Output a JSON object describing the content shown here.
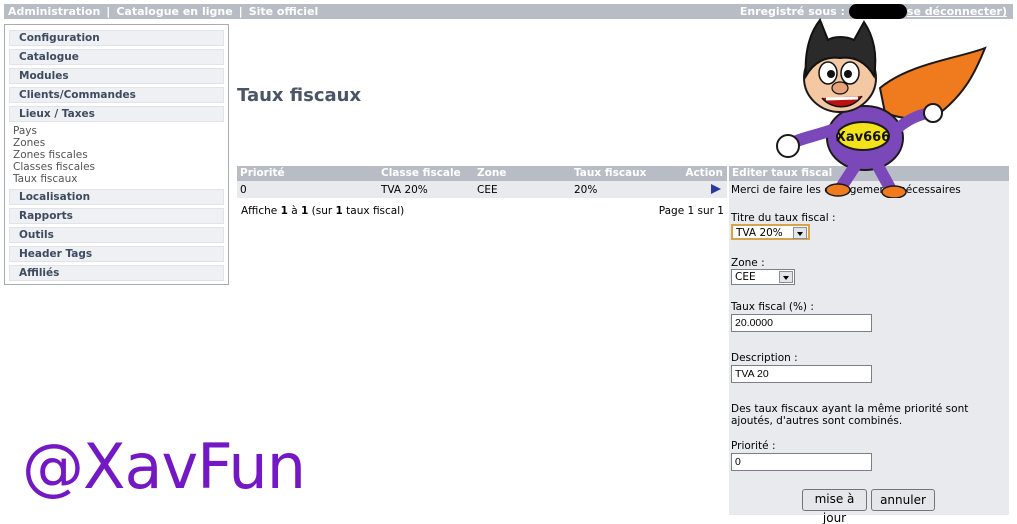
{
  "topbar": {
    "links": [
      "Administration",
      "Catalogue en ligne",
      "Site officiel"
    ],
    "registered_label": "Enregistré sous :",
    "logout": "se déconnecter)"
  },
  "menu": {
    "sections": [
      {
        "label": "Configuration"
      },
      {
        "label": "Catalogue"
      },
      {
        "label": "Modules"
      },
      {
        "label": "Clients/Commandes"
      },
      {
        "label": "Lieux / Taxes",
        "items": [
          "Pays",
          "Zones",
          "Zones fiscales",
          "Classes fiscales",
          "Taux fiscaux"
        ]
      },
      {
        "label": "Localisation"
      },
      {
        "label": "Rapports"
      },
      {
        "label": "Outils"
      },
      {
        "label": "Header Tags"
      },
      {
        "label": "Affiliés"
      }
    ]
  },
  "page": {
    "title": "Taux fiscaux"
  },
  "table": {
    "headers": [
      "Priorité",
      "Classe fiscale",
      "Zone",
      "Taux fiscaux",
      "Action"
    ],
    "rows": [
      [
        "0",
        "TVA 20%",
        "CEE",
        "20%"
      ]
    ],
    "pager_prefix": "Affiche ",
    "pager_from": "1",
    "pager_mid": " à ",
    "pager_to": "1",
    "pager_sur": " (sur ",
    "pager_total": "1",
    "pager_suffix": " taux fiscal)",
    "page_info": "Page 1 sur 1"
  },
  "edit": {
    "title": "Editer taux fiscal",
    "intro": "Merci de faire les changements nécessaires",
    "title_label": "Titre du taux fiscal :",
    "title_value": "TVA 20%",
    "zone_label": "Zone :",
    "zone_value": "CEE",
    "rate_label": "Taux fiscal (%) :",
    "rate_value": "20.0000",
    "desc_label": "Description :",
    "desc_value": "TVA 20",
    "note_line1": "Des taux fiscaux ayant la même priorité sont",
    "note_line2": "ajoutés, d'autres sont combinés.",
    "priority_label": "Priorité :",
    "priority_value": "0",
    "update_button": "mise à jour",
    "cancel_button": "annuler"
  },
  "mascot": {
    "badge_text": "Xav666"
  },
  "watermark": "@XavFun",
  "colors": {
    "bar": "#b8bcc4",
    "row": "#e8eaee",
    "title": "#4a5566",
    "watermark": "#7318c4"
  }
}
